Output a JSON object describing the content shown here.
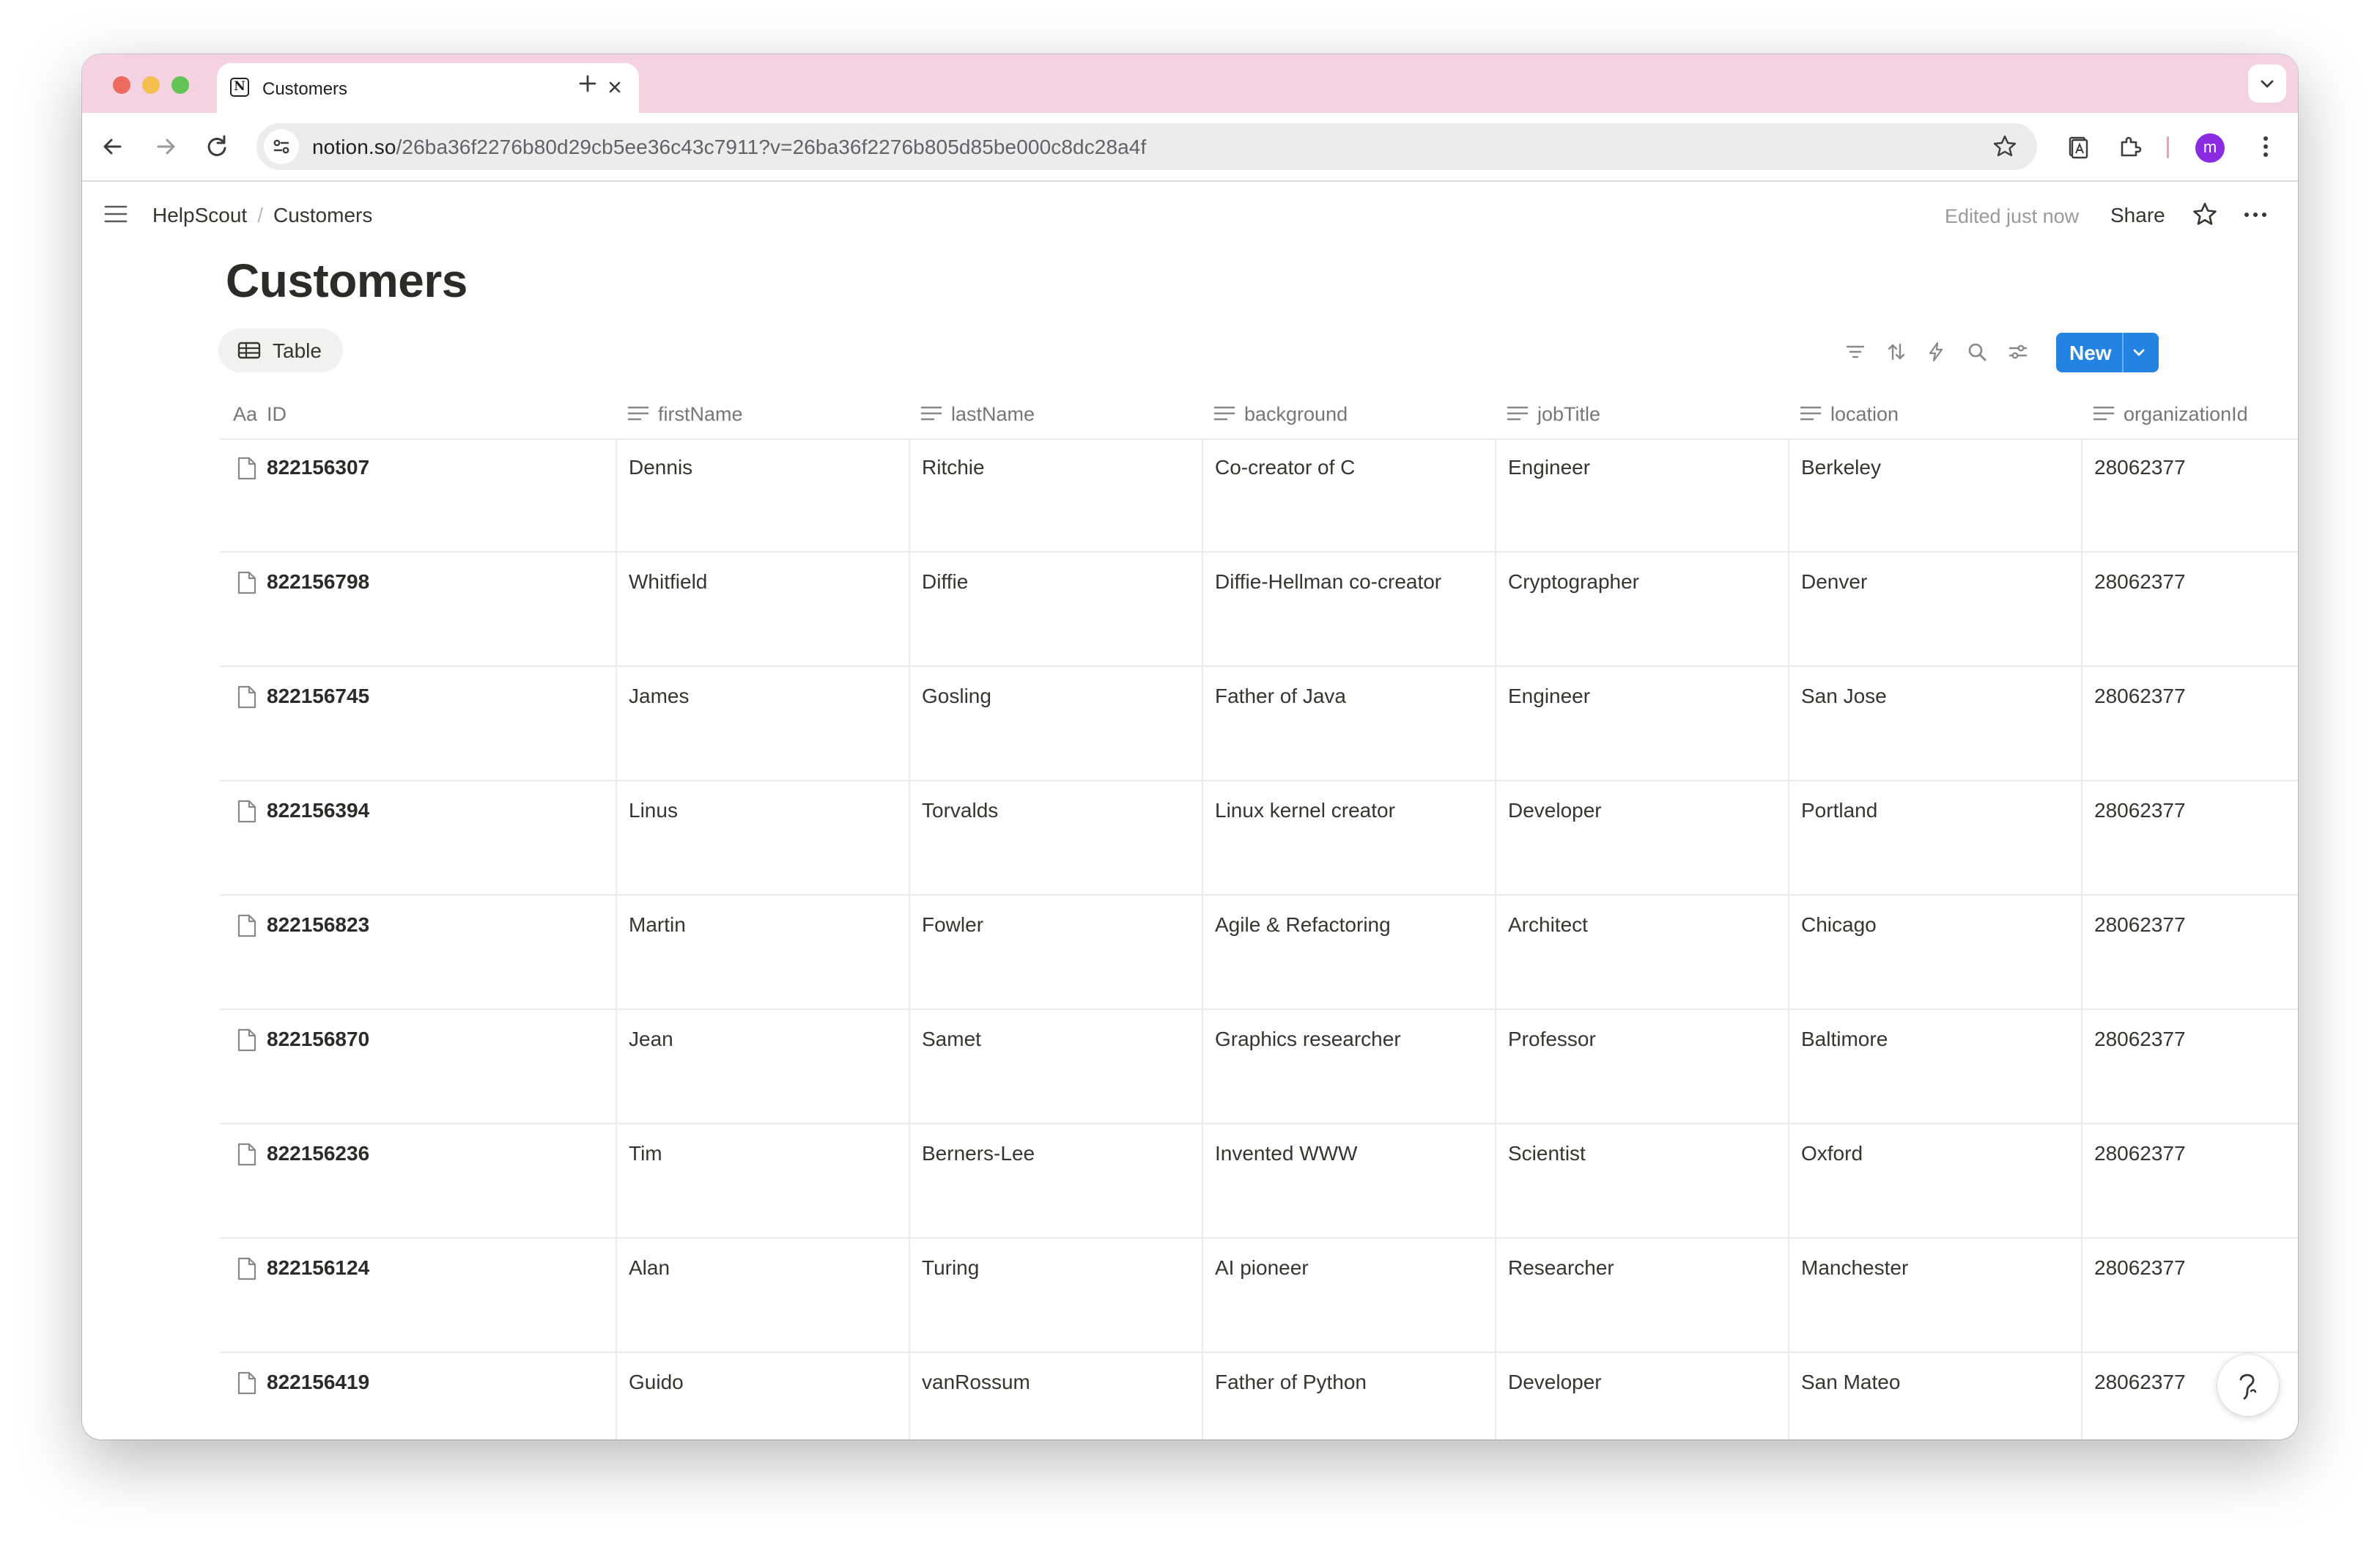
{
  "browser": {
    "tab_title": "Customers",
    "url_host": "notion.so",
    "url_path": "/26ba36f2276b80d29cb5ee36c43c7911?v=26ba36f2276b805d85be000c8dc28a4f",
    "avatar_letter": "m",
    "tab_strip_color": "#f5d2e2"
  },
  "topbar": {
    "breadcrumb_workspace": "HelpScout",
    "breadcrumb_page": "Customers",
    "edited_status": "Edited just now",
    "share_label": "Share"
  },
  "page": {
    "title": "Customers",
    "view_tab_label": "Table",
    "new_button_label": "New",
    "accent_color": "#2383e2"
  },
  "table": {
    "columns": [
      {
        "label": "ID",
        "type_icon": "title-aa-icon"
      },
      {
        "label": "firstName",
        "type_icon": "text-lines-icon"
      },
      {
        "label": "lastName",
        "type_icon": "text-lines-icon"
      },
      {
        "label": "background",
        "type_icon": "text-lines-icon"
      },
      {
        "label": "jobTitle",
        "type_icon": "text-lines-icon"
      },
      {
        "label": "location",
        "type_icon": "text-lines-icon"
      },
      {
        "label": "organizationId",
        "type_icon": "text-lines-icon"
      }
    ],
    "rows": [
      {
        "id": "822156307",
        "firstName": "Dennis",
        "lastName": "Ritchie",
        "background": "Co-creator of C",
        "jobTitle": "Engineer",
        "location": "Berkeley",
        "organizationId": "28062377"
      },
      {
        "id": "822156798",
        "firstName": "Whitfield",
        "lastName": "Diffie",
        "background": "Diffie-Hellman co-creator",
        "jobTitle": "Cryptographer",
        "location": "Denver",
        "organizationId": "28062377"
      },
      {
        "id": "822156745",
        "firstName": "James",
        "lastName": "Gosling",
        "background": "Father of Java",
        "jobTitle": "Engineer",
        "location": "San Jose",
        "organizationId": "28062377"
      },
      {
        "id": "822156394",
        "firstName": "Linus",
        "lastName": "Torvalds",
        "background": "Linux kernel creator",
        "jobTitle": "Developer",
        "location": "Portland",
        "organizationId": "28062377"
      },
      {
        "id": "822156823",
        "firstName": "Martin",
        "lastName": "Fowler",
        "background": "Agile & Refactoring",
        "jobTitle": "Architect",
        "location": "Chicago",
        "organizationId": "28062377"
      },
      {
        "id": "822156870",
        "firstName": "Jean",
        "lastName": "Samet",
        "background": "Graphics researcher",
        "jobTitle": "Professor",
        "location": "Baltimore",
        "organizationId": "28062377"
      },
      {
        "id": "822156236",
        "firstName": "Tim",
        "lastName": "Berners-Lee",
        "background": "Invented WWW",
        "jobTitle": "Scientist",
        "location": "Oxford",
        "organizationId": "28062377"
      },
      {
        "id": "822156124",
        "firstName": "Alan",
        "lastName": "Turing",
        "background": "AI pioneer",
        "jobTitle": "Researcher",
        "location": "Manchester",
        "organizationId": "28062377"
      },
      {
        "id": "822156419",
        "firstName": "Guido",
        "lastName": "vanRossum",
        "background": "Father of Python",
        "jobTitle": "Developer",
        "location": "San Mateo",
        "organizationId": "28062377"
      }
    ]
  }
}
